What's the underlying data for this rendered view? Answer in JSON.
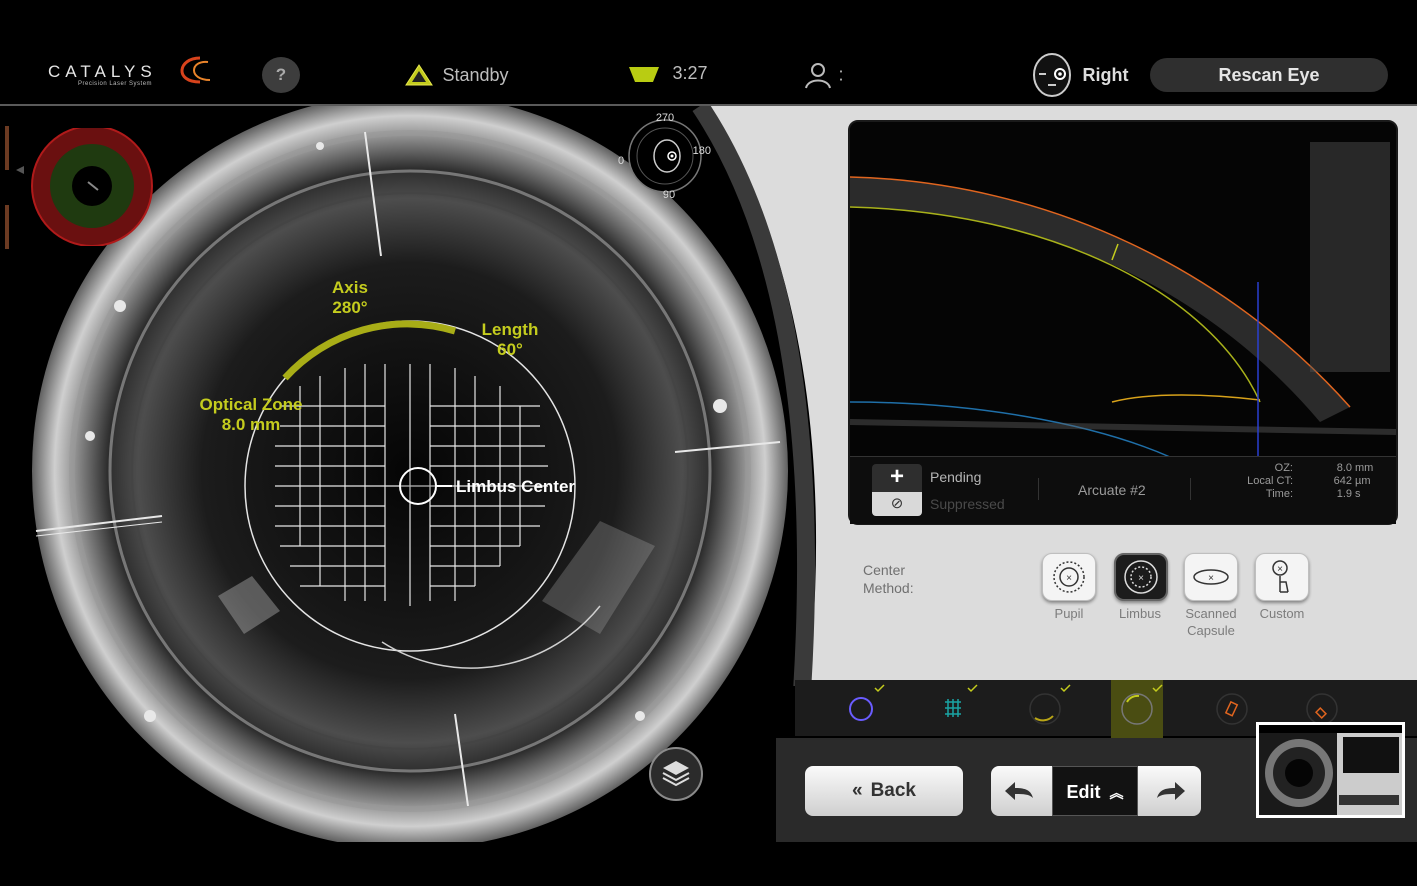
{
  "header": {
    "logo_name": "CATALYS",
    "logo_tagline": "Precision Laser System",
    "help_label": "?",
    "status": "Standby",
    "timer": "3:27",
    "user_suffix": ":",
    "eye": "Right",
    "rescan_label": "Rescan Eye"
  },
  "viewer": {
    "axis_title": "Axis",
    "axis_value": "280°",
    "length_title": "Length",
    "length_value": "60°",
    "oz_title": "Optical Zone",
    "oz_value": "8.0 mm",
    "center_label": "Limbus Center",
    "orient_top": "270",
    "orient_right": "180",
    "orient_bottom": "90",
    "orient_left": "0"
  },
  "oct": {
    "state_pending": "Pending",
    "state_suppressed": "Suppressed",
    "incision": "Arcuate #2",
    "metrics": [
      {
        "label": "OZ:",
        "value": "8.0",
        "unit": "mm"
      },
      {
        "label": "Local CT:",
        "value": "642",
        "unit": "µm"
      },
      {
        "label": "Time:",
        "value": "1.9",
        "unit": "s"
      }
    ]
  },
  "center_method": {
    "label_line1": "Center",
    "label_line2": "Method:",
    "options": [
      {
        "line1": "Pupil",
        "line2": ""
      },
      {
        "line1": "Limbus",
        "line2": ""
      },
      {
        "line1": "Scanned",
        "line2": "Capsule"
      },
      {
        "line1": "Custom",
        "line2": ""
      }
    ],
    "selected": "Limbus"
  },
  "steps": {
    "completed_count": 4,
    "active_index": 3
  },
  "nav": {
    "back_label": "Back",
    "edit_label": "Edit"
  },
  "colors": {
    "accent_yellow": "#c4cc1e",
    "oct_orange": "#e0651f",
    "oct_blue": "#1f6fa8"
  }
}
